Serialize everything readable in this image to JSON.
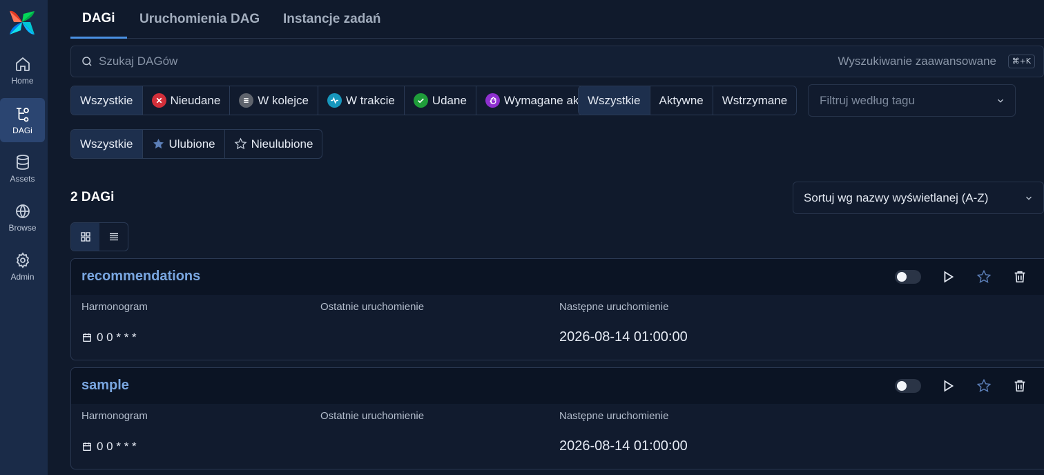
{
  "sidebar": {
    "items": [
      {
        "label": "Home",
        "icon": "home-icon"
      },
      {
        "label": "DAGi",
        "icon": "dag-icon",
        "active": true
      },
      {
        "label": "Assets",
        "icon": "database-icon"
      },
      {
        "label": "Browse",
        "icon": "globe-icon"
      },
      {
        "label": "Admin",
        "icon": "gear-icon"
      }
    ]
  },
  "tabs": [
    {
      "label": "DAGi",
      "active": true
    },
    {
      "label": "Uruchomienia DAG"
    },
    {
      "label": "Instancje zadań"
    }
  ],
  "search": {
    "placeholder": "Szukaj DAGów",
    "value": "",
    "advanced_label": "Wyszukiwanie zaawansowane",
    "shortcut": "⌘+K"
  },
  "state_filters": [
    {
      "label": "Wszystkie",
      "active": true
    },
    {
      "label": "Nieudane",
      "icon": "x-icon",
      "color": "#d32f3a"
    },
    {
      "label": "W kolejce",
      "icon": "queue-icon",
      "color": "#5f646d"
    },
    {
      "label": "W trakcie",
      "icon": "activity-icon",
      "color": "#1797bd"
    },
    {
      "label": "Udane",
      "icon": "check-icon",
      "color": "#1f9d3a"
    },
    {
      "label": "Wymagane akcje",
      "icon": "hand-icon",
      "color": "#8e30cf"
    }
  ],
  "active_filters": [
    {
      "label": "Wszystkie",
      "active": true
    },
    {
      "label": "Aktywne"
    },
    {
      "label": "Wstrzymane"
    }
  ],
  "tag_filter": {
    "placeholder": "Filtruj według tagu"
  },
  "favorite_filters": [
    {
      "label": "Wszystkie",
      "active": true
    },
    {
      "label": "Ulubione",
      "icon": "star-filled-icon"
    },
    {
      "label": "Nieulubione",
      "icon": "star-outline-icon"
    }
  ],
  "count_label": "2 DAGi",
  "sort": {
    "label": "Sortuj wg nazwy wyświetlanej (A-Z)"
  },
  "columns": {
    "schedule": "Harmonogram",
    "last_run": "Ostatnie uruchomienie",
    "next_run": "Następne uruchomienie"
  },
  "dags": [
    {
      "name": "recommendations",
      "schedule": "0 0 * * *",
      "last_run": "",
      "next_run": "2026-08-14 01:00:00",
      "paused": true
    },
    {
      "name": "sample",
      "schedule": "0 0 * * *",
      "last_run": "",
      "next_run": "2026-08-14 01:00:00",
      "paused": true
    }
  ]
}
